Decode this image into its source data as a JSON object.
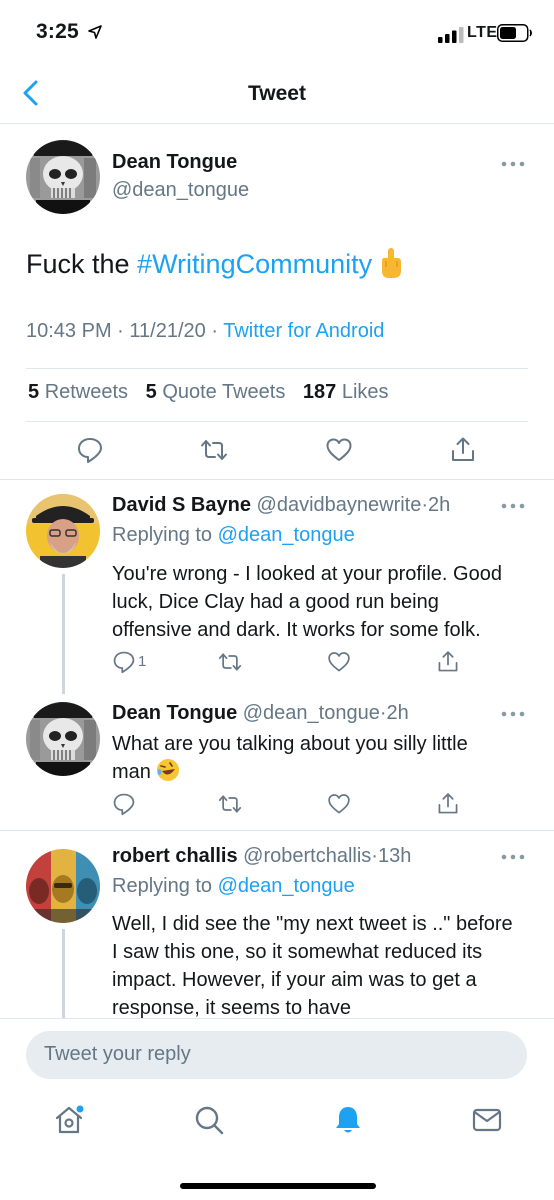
{
  "status_bar": {
    "time": "3:25",
    "network": "LTE"
  },
  "nav": {
    "title": "Tweet"
  },
  "main_tweet": {
    "name": "Dean Tongue",
    "handle": "@dean_tongue",
    "text_prefix": "Fuck the ",
    "hashtag": "#WritingCommunity",
    "time": "10:43 PM",
    "date": "11/21/20",
    "separator": "·",
    "source": "Twitter for Android",
    "retweets_count": "5",
    "retweets_label": "Retweets",
    "quotes_count": "5",
    "quotes_label": "Quote Tweets",
    "likes_count": "187",
    "likes_label": "Likes"
  },
  "replies": [
    {
      "name": "David S Bayne",
      "handle": "@davidbaynewrite",
      "time": "2h",
      "replying_label": "Replying to",
      "replying_to": "@dean_tongue",
      "text": "You're wrong - I looked at your profile. Good luck, Dice Clay had a good run being offensive and dark. It works for some folk.",
      "reply_count": "1"
    },
    {
      "name": "Dean Tongue",
      "handle": "@dean_tongue",
      "time": "2h",
      "text": "What are you talking about you silly little man"
    },
    {
      "name": "robert challis",
      "handle": "@robertchallis",
      "time": "13h",
      "replying_label": "Replying to",
      "replying_to": "@dean_tongue",
      "text": "Well, I did see the \"my next tweet is ..\" before I saw this one, so it somewhat reduced its impact. However, if your aim was to get a response, it seems to have"
    }
  ],
  "composer": {
    "placeholder": "Tweet your reply"
  },
  "tabs": [
    "home-icon",
    "search-icon",
    "notifications-icon",
    "messages-icon"
  ],
  "colors": {
    "accent": "#1da1f2",
    "secondary_text": "#657786",
    "divider": "#e1e8ed"
  }
}
